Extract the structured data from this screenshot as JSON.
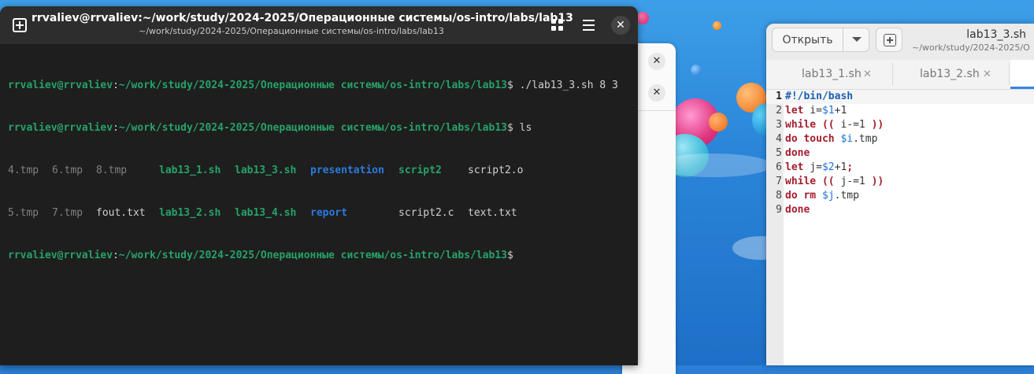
{
  "terminal": {
    "title": "rrvaliev@rrvaliev:~/work/study/2024-2025/Операционные системы/os-intro/labs/lab13",
    "subtitle": "~/work/study/2024-2025/Операционные системы/os-intro/labs/lab13",
    "new_tab_icon": "new-tab-icon",
    "grid_icon": "grid-icon",
    "menu_icon": "hamburger-menu-icon",
    "close_label": "✕",
    "prompt_user": "rrvaliev@rrvaliev",
    "prompt_path": "~/work/study/2024-2025/Операционные системы/os-intro/labs/lab13",
    "prompt_symbol": "$",
    "commands": [
      "./lab13_3.sh 8 3",
      "ls",
      ""
    ],
    "ls_row1": [
      {
        "text": "4.tmp",
        "kind": "tmp"
      },
      {
        "text": "6.tmp",
        "kind": "tmp"
      },
      {
        "text": "8.tmp",
        "kind": "tmp"
      },
      {
        "text": "lab13_1.sh",
        "kind": "exe"
      },
      {
        "text": "lab13_3.sh",
        "kind": "exe"
      },
      {
        "text": "presentation",
        "kind": "dir"
      },
      {
        "text": "script2",
        "kind": "exe"
      },
      {
        "text": "script2.o",
        "kind": "plain"
      }
    ],
    "ls_row2": [
      {
        "text": "5.tmp",
        "kind": "tmp"
      },
      {
        "text": "7.tmp",
        "kind": "tmp"
      },
      {
        "text": "fout.txt",
        "kind": "plain"
      },
      {
        "text": "lab13_2.sh",
        "kind": "exe"
      },
      {
        "text": "lab13_4.sh",
        "kind": "exe"
      },
      {
        "text": "report",
        "kind": "dir"
      },
      {
        "text": "script2.c",
        "kind": "plain"
      },
      {
        "text": "text.txt",
        "kind": "plain"
      }
    ],
    "colors": {
      "prompt": "#26a269",
      "directory": "#2a7bde",
      "tmp": "#808080",
      "background": "#1e1e1e"
    }
  },
  "behind_window": {
    "close_label_1": "✕",
    "close_label_2": "✕"
  },
  "editor": {
    "open_label": "Открыть",
    "dropdown_icon": "chevron-down-icon",
    "new_doc_icon": "new-document-icon",
    "title": "lab13_3.sh",
    "subtitle": "~/work/study/2024-2025/O",
    "tabs": [
      {
        "label": "lab13_1.sh",
        "close": "✕"
      },
      {
        "label": "lab13_2.sh",
        "close": "✕"
      }
    ],
    "current_line": 1,
    "lines": [
      {
        "n": "1",
        "parts": [
          {
            "t": "#!/bin/bash",
            "c": "shebang"
          }
        ]
      },
      {
        "n": "2",
        "parts": [
          {
            "t": "let",
            "c": "kw"
          },
          {
            "t": " i=",
            "c": ""
          },
          {
            "t": "$1",
            "c": "var"
          },
          {
            "t": "+1",
            "c": ""
          }
        ]
      },
      {
        "n": "3",
        "parts": [
          {
            "t": "while",
            "c": "kw"
          },
          {
            "t": " ",
            "c": ""
          },
          {
            "t": "((",
            "c": "kw"
          },
          {
            "t": " i-=1 ",
            "c": ""
          },
          {
            "t": "))",
            "c": "kw"
          }
        ]
      },
      {
        "n": "4",
        "parts": [
          {
            "t": "do",
            "c": "kw"
          },
          {
            "t": " ",
            "c": ""
          },
          {
            "t": "touch",
            "c": "kw"
          },
          {
            "t": " ",
            "c": ""
          },
          {
            "t": "$i",
            "c": "var"
          },
          {
            "t": ".tmp",
            "c": ""
          }
        ]
      },
      {
        "n": "5",
        "parts": [
          {
            "t": "done",
            "c": "kw"
          }
        ]
      },
      {
        "n": "6",
        "parts": [
          {
            "t": "let",
            "c": "kw"
          },
          {
            "t": " j=",
            "c": ""
          },
          {
            "t": "$2",
            "c": "var"
          },
          {
            "t": "+1",
            "c": ""
          },
          {
            "t": ";",
            "c": "kw"
          }
        ]
      },
      {
        "n": "7",
        "parts": [
          {
            "t": "while",
            "c": "kw"
          },
          {
            "t": " ",
            "c": ""
          },
          {
            "t": "((",
            "c": "kw"
          },
          {
            "t": " j-=1 ",
            "c": ""
          },
          {
            "t": "))",
            "c": "kw"
          }
        ]
      },
      {
        "n": "8",
        "parts": [
          {
            "t": "do",
            "c": "kw"
          },
          {
            "t": " ",
            "c": ""
          },
          {
            "t": "rm",
            "c": "kw"
          },
          {
            "t": " ",
            "c": ""
          },
          {
            "t": "$j",
            "c": "var"
          },
          {
            "t": ".tmp",
            "c": ""
          }
        ]
      },
      {
        "n": "9",
        "parts": [
          {
            "t": "done",
            "c": "kw"
          }
        ]
      }
    ],
    "colors": {
      "keyword": "#a51d2d",
      "variable": "#1c71d8",
      "accent": "#3584e4"
    }
  }
}
